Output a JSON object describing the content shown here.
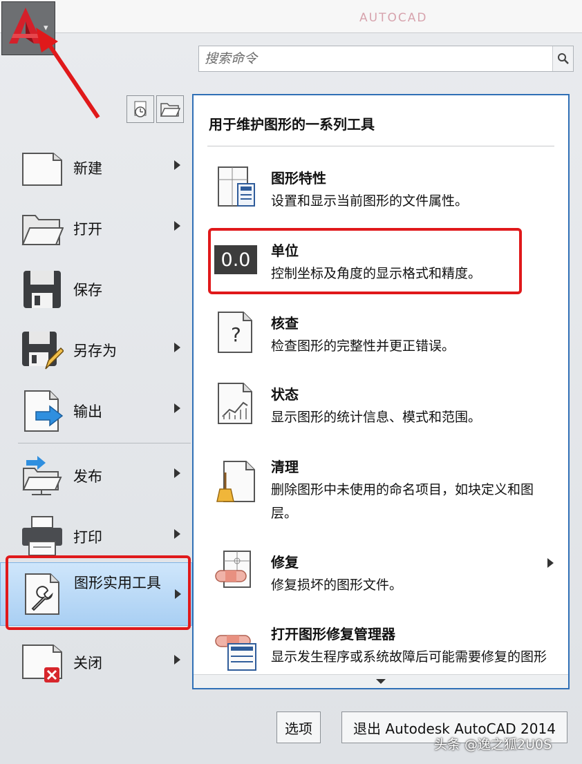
{
  "header": {
    "wordmark": "AUTOCAD"
  },
  "search": {
    "placeholder": "搜索命令"
  },
  "left_menu": {
    "items": [
      {
        "label": "新建"
      },
      {
        "label": "打开"
      },
      {
        "label": "保存"
      },
      {
        "label": "另存为"
      },
      {
        "label": "输出"
      },
      {
        "label": "发布"
      },
      {
        "label": "打印"
      },
      {
        "label": "图形实用工具"
      },
      {
        "label": "关闭"
      }
    ]
  },
  "flyout": {
    "heading": "用于维护图形的一系列工具",
    "items": [
      {
        "title": "图形特性",
        "desc": "设置和显示当前图形的文件属性。"
      },
      {
        "title": "单位",
        "desc": "控制坐标及角度的显示格式和精度。",
        "badge": "0.0"
      },
      {
        "title": "核查",
        "desc": "检查图形的完整性并更正错误。"
      },
      {
        "title": "状态",
        "desc": "显示图形的统计信息、模式和范围。"
      },
      {
        "title": "清理",
        "desc": "删除图形中未使用的命名项目，如块定义和图层。"
      },
      {
        "title": "修复",
        "desc": "修复损坏的图形文件。"
      },
      {
        "title": "打开图形修复管理器",
        "desc": "显示发生程序或系统故障后可能需要修复的图形"
      }
    ]
  },
  "footer": {
    "options_label": "选项",
    "exit_label": "退出 Autodesk AutoCAD 2014"
  },
  "watermark": "头条 @逸之狐2U0S",
  "colors": {
    "accent_blue": "#2f6fb6",
    "annotation_red": "#e0191b",
    "active_item": "#b7d8f6"
  }
}
